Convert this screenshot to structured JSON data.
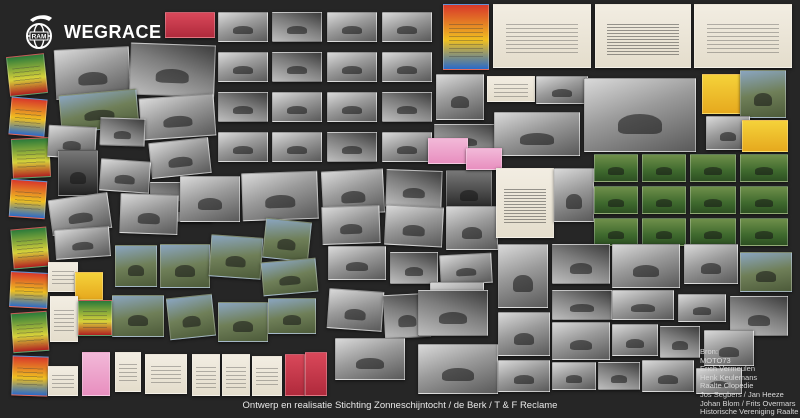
{
  "brand": {
    "name": "WEGRACE",
    "logo_text": "RAM",
    "logo_icon": "globe-rider-icon"
  },
  "footer": {
    "text": "Ontwerp en realisatie Stichting Zonneschijntocht / de Berk / T & F Reclame"
  },
  "credits": {
    "title": "Bron:",
    "lines": [
      "MOTO73",
      "Erich Vermeulen",
      "Henk Keulemans",
      "Raalte Clopedie",
      "Jos Segbers / Jan Heeze",
      "Johan Blom / Frits Overmars",
      "Historische Vereniging Raalte"
    ]
  },
  "photos": [
    {
      "name": "photo-bw",
      "style": "bw"
    },
    {
      "name": "photo-green",
      "style": "grn"
    },
    {
      "name": "photo-color",
      "style": "col"
    },
    {
      "name": "magazine-cover",
      "style": "mag"
    },
    {
      "name": "newspaper-clipping",
      "style": "paper"
    },
    {
      "name": "programme-leaflet",
      "style": "pink"
    }
  ]
}
